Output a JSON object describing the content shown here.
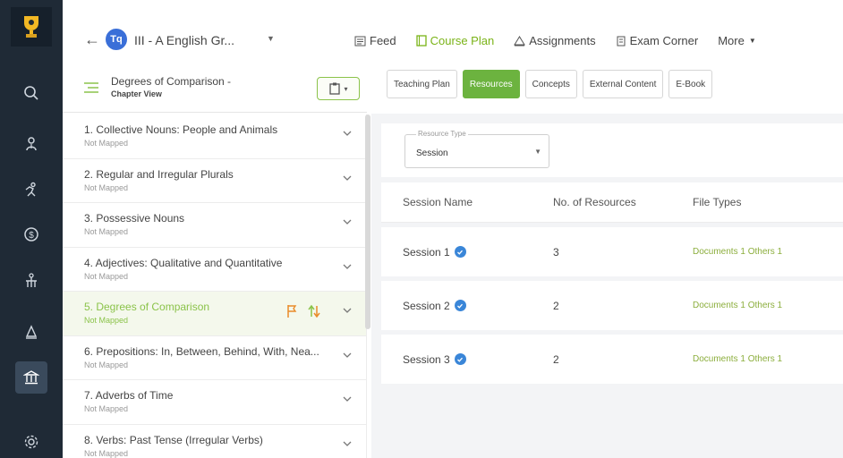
{
  "header": {
    "class_badge": "Tq",
    "class_name": "III - A  English Gr...",
    "nav": [
      {
        "label": "Feed",
        "icon": "feed-icon"
      },
      {
        "label": "Course Plan",
        "icon": "course-plan-icon",
        "active": true
      },
      {
        "label": "Assignments",
        "icon": "assignments-icon"
      },
      {
        "label": "Exam Corner",
        "icon": "exam-corner-icon"
      },
      {
        "label": "More",
        "icon": "chevron-down-icon"
      }
    ]
  },
  "chapter_panel": {
    "title": "Degrees of Comparison -",
    "subtitle": "Chapter View",
    "chapters": [
      {
        "name": "1.  Collective Nouns: People and Animals",
        "status": "Not Mapped"
      },
      {
        "name": "2.  Regular and Irregular Plurals",
        "status": "Not Mapped"
      },
      {
        "name": "3.  Possessive Nouns",
        "status": "Not Mapped"
      },
      {
        "name": "4.  Adjectives: Qualitative and Quantitative",
        "status": "Not Mapped"
      },
      {
        "name": "5.  Degrees of Comparison",
        "status": "Not Mapped",
        "selected": true
      },
      {
        "name": "6.  Prepositions: In, Between, Behind, With, Nea...",
        "status": "Not Mapped"
      },
      {
        "name": "7.  Adverbs of Time",
        "status": "Not Mapped"
      },
      {
        "name": "8.  Verbs: Past Tense (Irregular Verbs)",
        "status": "Not Mapped"
      }
    ]
  },
  "tabs": [
    {
      "label": "Teaching Plan"
    },
    {
      "label": "Resources",
      "active": true
    },
    {
      "label": "Concepts"
    },
    {
      "label": "External Content"
    },
    {
      "label": "E-Book"
    }
  ],
  "filter": {
    "label": "Resource Type",
    "value": "Session"
  },
  "table": {
    "columns": [
      "Session Name",
      "No. of Resources",
      "File Types"
    ],
    "rows": [
      {
        "name": "Session 1",
        "count": "3",
        "types": "Documents 1  Others 1"
      },
      {
        "name": "Session 2",
        "count": "2",
        "types": "Documents 1  Others 1"
      },
      {
        "name": "Session 3",
        "count": "2",
        "types": "Documents 1  Others 1"
      }
    ]
  },
  "colors": {
    "accent": "#6cb33f",
    "rail": "#1f2a36",
    "link": "#3a86d8"
  }
}
